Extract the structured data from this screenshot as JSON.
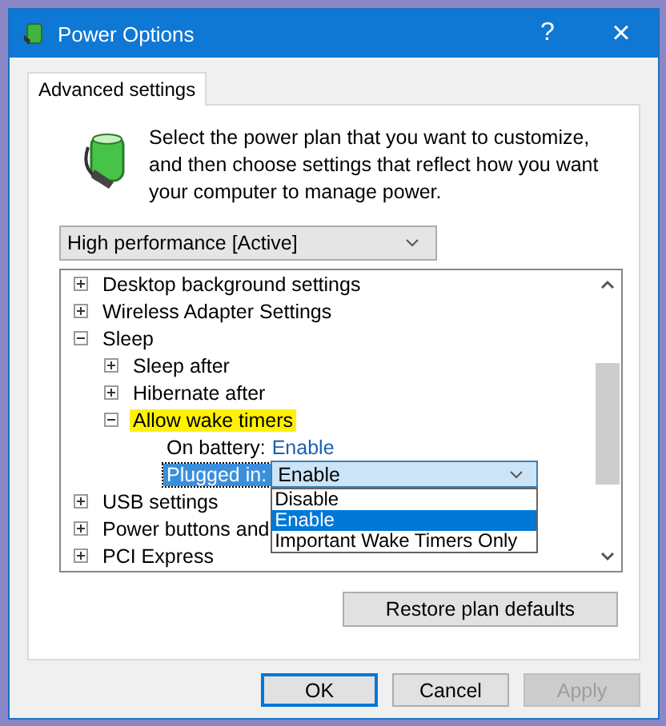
{
  "window": {
    "title": "Power Options",
    "help": "?",
    "close": "×"
  },
  "tabs": [
    {
      "label": "Advanced settings",
      "selected": true
    }
  ],
  "description": "Select the power plan that you want to customize, and then choose settings that reflect how you want your computer to manage power.",
  "plan_dropdown": {
    "value": "High performance [Active]"
  },
  "tree": [
    {
      "label": "Desktop background settings",
      "expanded": false
    },
    {
      "label": "Wireless Adapter Settings",
      "expanded": false
    },
    {
      "label": "Sleep",
      "expanded": true,
      "children": [
        {
          "label": "Sleep after",
          "expanded": false
        },
        {
          "label": "Hibernate after",
          "expanded": false
        },
        {
          "label": "Allow wake timers",
          "expanded": true,
          "highlighted": true,
          "children": [
            {
              "kind": "setting",
              "label": "On battery:",
              "value": "Enable",
              "selected": false
            },
            {
              "kind": "setting",
              "label": "Plugged in:",
              "value": "Enable",
              "selected": true,
              "options": [
                {
                  "label": "Disable",
                  "selected": false
                },
                {
                  "label": "Enable",
                  "selected": true
                },
                {
                  "label": "Important Wake Timers Only",
                  "selected": false
                }
              ]
            }
          ]
        }
      ]
    },
    {
      "label": "USB settings",
      "expanded": false
    },
    {
      "label": "Power buttons and",
      "expanded": false
    },
    {
      "label": "PCI Express",
      "expanded": false
    }
  ],
  "restore_button": "Restore plan defaults",
  "buttons": [
    {
      "label": "OK",
      "default": true,
      "disabled": false
    },
    {
      "label": "Cancel",
      "default": false,
      "disabled": false
    },
    {
      "label": "Apply",
      "default": false,
      "disabled": true
    }
  ]
}
